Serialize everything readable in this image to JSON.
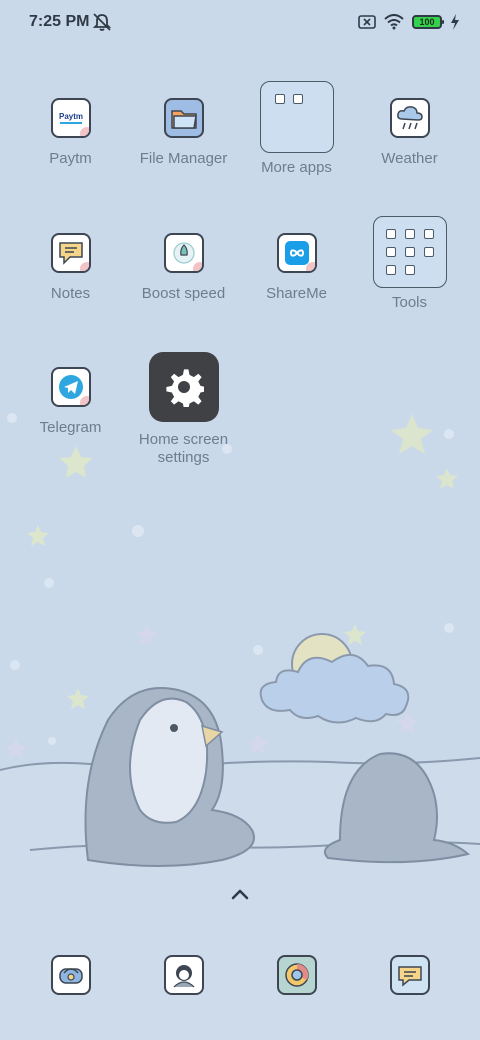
{
  "status_bar": {
    "time": "7:25 PM",
    "battery_level": "100",
    "icons": [
      "bell-off-icon",
      "sim-blocked-icon",
      "wifi-icon",
      "battery-icon",
      "charging-bolt-icon"
    ]
  },
  "home": {
    "apps": [
      {
        "label": "Paytm",
        "icon": "paytm-icon"
      },
      {
        "label": "File Manager",
        "icon": "folder-icon"
      },
      {
        "label": "More apps",
        "icon": "folder-icon"
      },
      {
        "label": "Weather",
        "icon": "cloud-rain-icon"
      },
      {
        "label": "Notes",
        "icon": "notes-icon"
      },
      {
        "label": "Boost speed",
        "icon": "rocket-icon"
      },
      {
        "label": "ShareMe",
        "icon": "infinity-icon"
      },
      {
        "label": "Tools",
        "icon": "folder-icon"
      },
      {
        "label": "Telegram",
        "icon": "paper-plane-icon"
      },
      {
        "label": "Home screen settings",
        "icon": "gear-icon"
      }
    ],
    "paytm_logo_text": "Paytm"
  },
  "dock": {
    "apps": [
      {
        "icon": "phone-icon"
      },
      {
        "icon": "contacts-icon"
      },
      {
        "icon": "browser-icon"
      },
      {
        "icon": "messages-icon"
      }
    ]
  },
  "colors": {
    "wallpaper": "#c9d9ea",
    "label_text": "#6d7d8f",
    "status_text": "#2f3a46",
    "battery_green": "#33d24a",
    "settings_tile": "#3f4144"
  }
}
